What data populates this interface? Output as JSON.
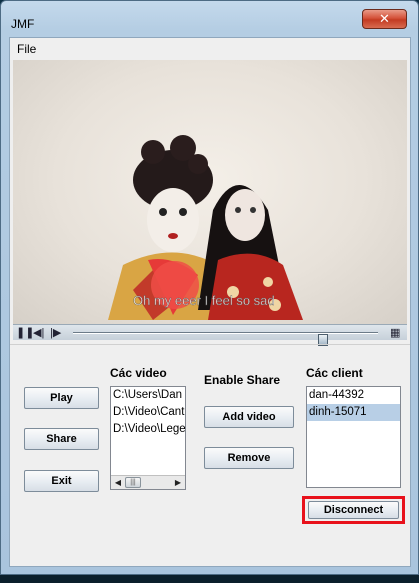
{
  "window": {
    "title": "JMF",
    "close_glyph": "✕"
  },
  "menu": {
    "file_label": "File"
  },
  "player": {
    "subtitle_overlay": "Oh my eeer I feel so sad",
    "controls": {
      "pause_icon": "pause-icon",
      "prev_frame_icon": "step-back-icon",
      "next_frame_icon": "step-forward-icon",
      "filmstrip_icon": "filmstrip-icon"
    },
    "progress_fraction": 0.83
  },
  "buttons": {
    "play": "Play",
    "share": "Share",
    "exit": "Exit",
    "add_video": "Add video",
    "remove": "Remove",
    "disconnect": "Disconnect"
  },
  "video_list": {
    "header": "Các video",
    "items": [
      "C:\\Users\\Dan",
      "D:\\Video\\Cant",
      "D:\\Video\\Lege"
    ]
  },
  "share": {
    "label": "Enable Share"
  },
  "client_list": {
    "header": "Các client",
    "items": [
      {
        "name": "dan-44392",
        "selected": false
      },
      {
        "name": "dinh-15071",
        "selected": true
      }
    ]
  },
  "colors": {
    "highlight_border": "#e8111b",
    "selection": "#b8cfe6",
    "window_frame": "#b4cde3"
  }
}
